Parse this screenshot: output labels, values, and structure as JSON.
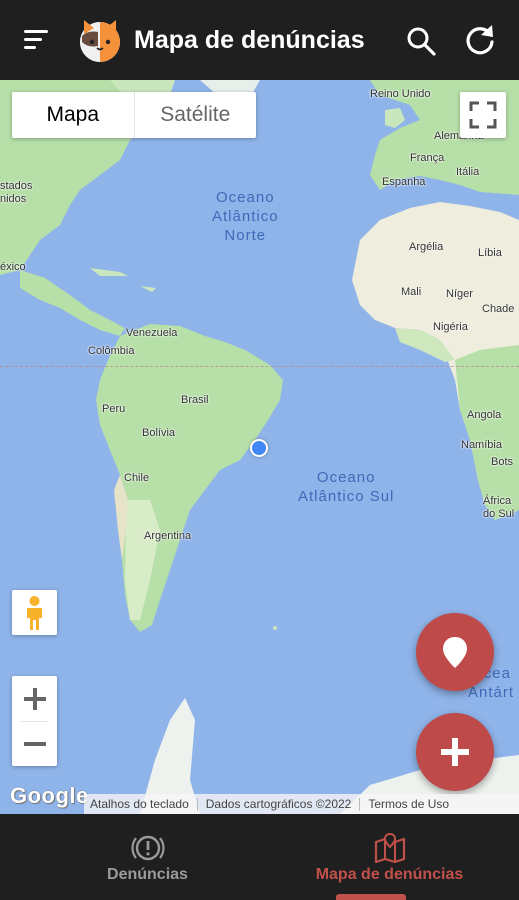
{
  "header": {
    "title": "Mapa de denúncias"
  },
  "map": {
    "type_options": [
      "Mapa",
      "Satélite"
    ],
    "selected_type": "Mapa",
    "oceans": {
      "north_atlantic": [
        "Oceano",
        "Atlântico",
        "Norte"
      ],
      "south_atlantic": [
        "Oceano",
        "Atlântico Sul"
      ]
    },
    "labels": {
      "reino_unido": "Reino Unido",
      "alemanha": "Alemanha",
      "franca": "França",
      "espanha": "Espanha",
      "italia": "Itália",
      "estados": "stados",
      "unidos": "nidos",
      "mexico": "éxico",
      "venezuela": "Venezuela",
      "colombia": "Colômbia",
      "peru": "Peru",
      "brasil": "Brasil",
      "bolivia": "Bolívia",
      "chile": "Chile",
      "argentina": "Argentina",
      "argelia": "Argélia",
      "libia": "Líbia",
      "mali": "Mali",
      "niger": "Níger",
      "chade": "Chade",
      "nigeria": "Nigéria",
      "angola": "Angola",
      "namibia": "Namíbia",
      "bots": "Bots",
      "africa": "África",
      "do_sul": "do Sul",
      "antartica_1": "Ocea",
      "antartica_2": "Antárt"
    },
    "attribution": {
      "brand": "Google",
      "keyboard": "Atalhos do teclado",
      "data": "Dados cartográficos ©2022",
      "terms": "Termos de Uso"
    }
  },
  "bottom_nav": {
    "items": [
      {
        "label": "Denúncias",
        "icon": "alert-circle-icon",
        "active": false
      },
      {
        "label": "Mapa de denúncias",
        "icon": "map-icon",
        "active": true
      }
    ],
    "active_color": "#c0504a",
    "inactive_color": "#9a9a9a"
  },
  "colors": {
    "fab": "#bf4a4a",
    "location_dot": "#4285f4",
    "ocean": "#8fb4ea",
    "land": "#b7dfa8"
  }
}
